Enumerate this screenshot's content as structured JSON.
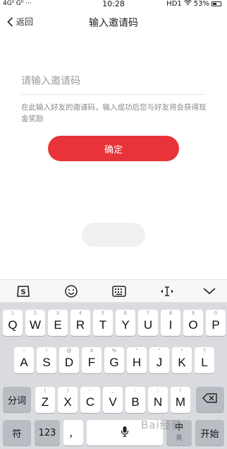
{
  "status_bar": {
    "signal": "4Gᴵᴵ Gᴵᴵ ···",
    "time": "10:28",
    "network": "HD1",
    "battery": "53%"
  },
  "nav": {
    "back_label": "返回",
    "title": "输入邀请码"
  },
  "form": {
    "input_placeholder": "请输入邀请码",
    "input_value": "",
    "hint": "在此输入好友的邀请码，输入成功后您与好友将会获得现金奖励",
    "confirm_label": "确定"
  },
  "keyboard": {
    "toolbar_icons": [
      "sogou-logo-icon",
      "emoji-icon",
      "keyboard-icon",
      "cursor-move-icon",
      "collapse-icon"
    ],
    "row1": [
      {
        "sub": "1",
        "main": "Q"
      },
      {
        "sub": "2",
        "main": "W"
      },
      {
        "sub": "3",
        "main": "E"
      },
      {
        "sub": "4",
        "main": "R"
      },
      {
        "sub": "5",
        "main": "T"
      },
      {
        "sub": "6",
        "main": "Y"
      },
      {
        "sub": "7",
        "main": "U"
      },
      {
        "sub": "8",
        "main": "I"
      },
      {
        "sub": "9",
        "main": "O"
      },
      {
        "sub": "0",
        "main": "P"
      }
    ],
    "row2": [
      {
        "sub": "~",
        "main": "A"
      },
      {
        "sub": "!",
        "main": "S"
      },
      {
        "sub": "@",
        "main": "D"
      },
      {
        "sub": "#",
        "main": "F"
      },
      {
        "sub": "%",
        "main": "G"
      },
      {
        "sub": "\"",
        "main": "H"
      },
      {
        "sub": "\"",
        "main": "J"
      },
      {
        "sub": "*",
        "main": "K"
      },
      {
        "sub": "?",
        "main": "L"
      }
    ],
    "row3": [
      {
        "sub": "(",
        "main": "Z"
      },
      {
        "sub": ")",
        "main": "X"
      },
      {
        "sub": "-",
        "main": "C"
      },
      {
        "sub": "_",
        "main": "V"
      },
      {
        "sub": ":",
        "main": "B"
      },
      {
        "sub": ";",
        "main": "N"
      },
      {
        "sub": "/",
        "main": "M"
      }
    ],
    "segment_label": "分词",
    "symbol_label": "符",
    "num_label": "123",
    "comma_label": "，",
    "cn_en_label": "中",
    "cn_en_sub": "英",
    "enter_label": "开始"
  },
  "watermark": "Bai经验"
}
